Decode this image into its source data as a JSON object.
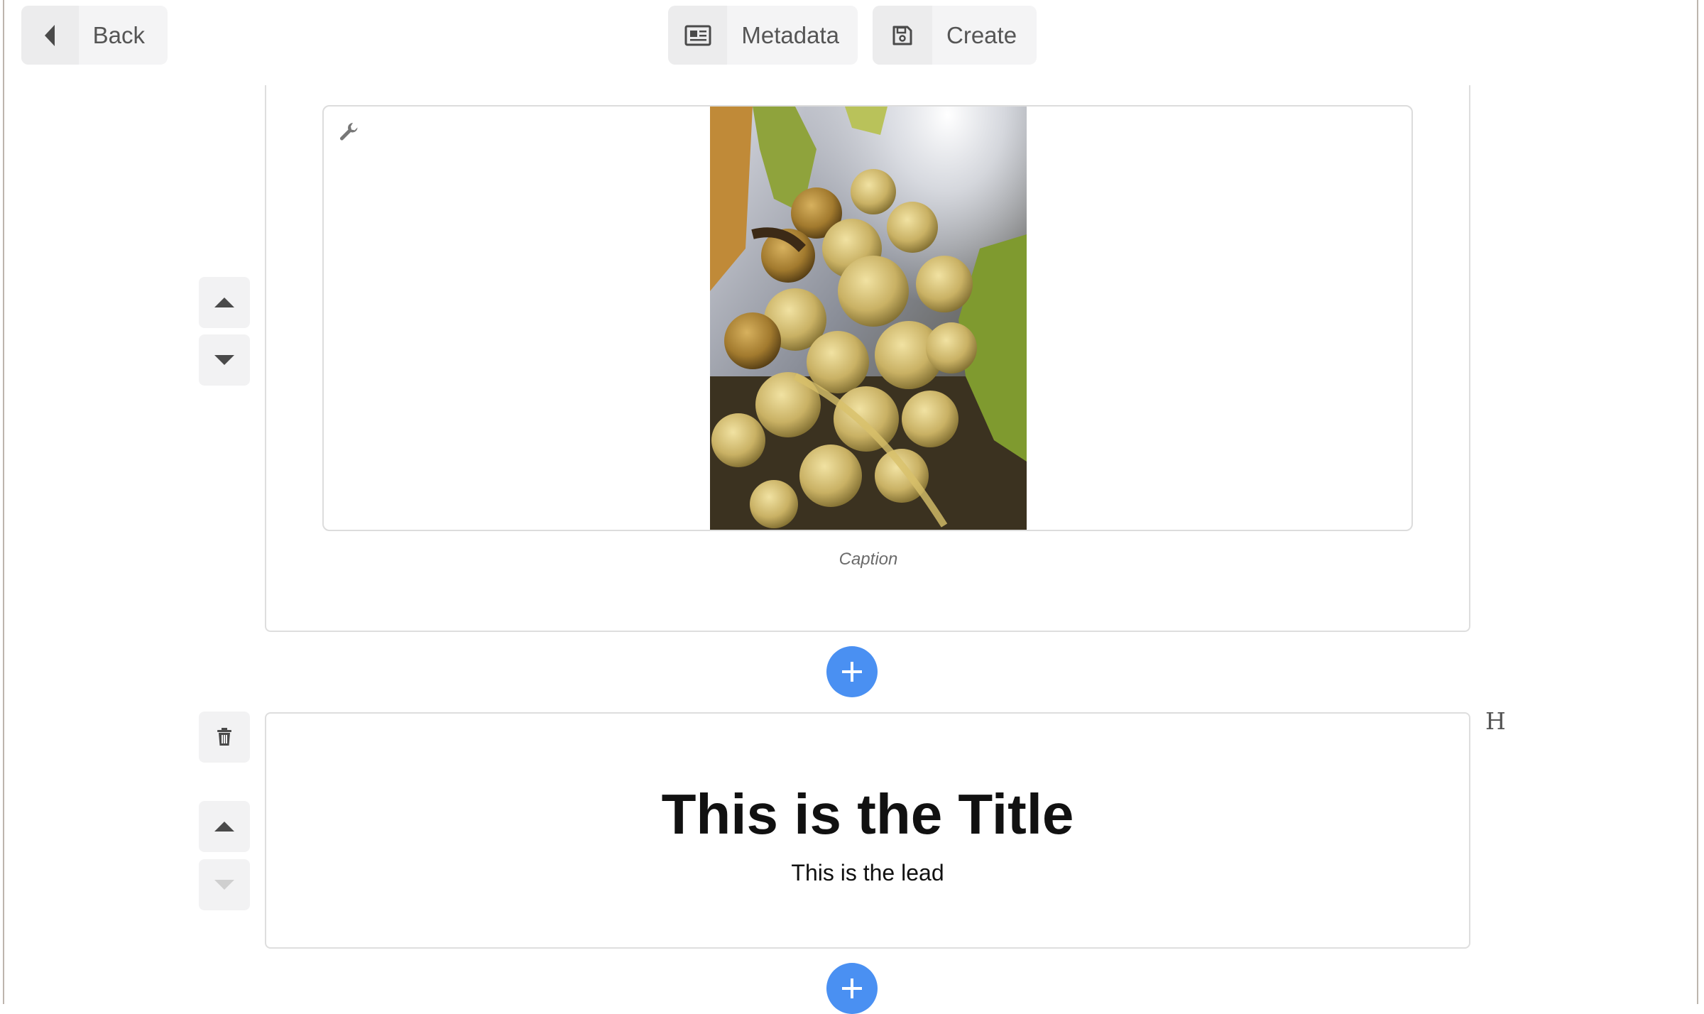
{
  "toolbar": {
    "back_label": "Back",
    "metadata_label": "Metadata",
    "create_label": "Create"
  },
  "image_block": {
    "caption": "Caption",
    "image_alt": "Bunch of green grapes in sunlight"
  },
  "title_block": {
    "title": "This is the Title",
    "lead": "This is the lead",
    "type_indicator": "H"
  },
  "colors": {
    "accent": "#4a90f2",
    "button_bg": "#f4f4f5",
    "border": "#dedede"
  },
  "icons": {
    "back": "chevron-left-icon",
    "metadata": "newspaper-icon",
    "create": "save-icon",
    "settings": "wrench-icon",
    "add": "plus-icon",
    "delete": "trash-icon",
    "move_up": "caret-up-icon",
    "move_down": "caret-down-icon"
  }
}
